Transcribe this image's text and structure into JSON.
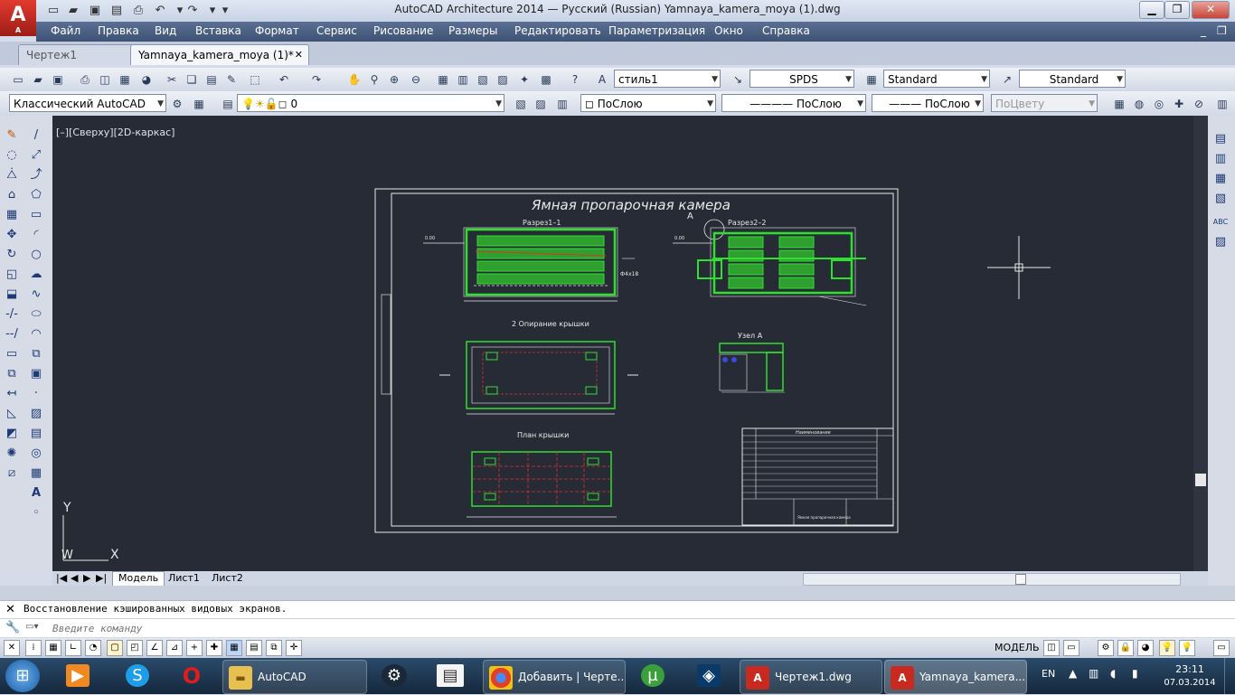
{
  "window": {
    "title": "AutoCAD Architecture 2014 — Русский (Russian)    Yamnaya_kamera_moya (1).dwg",
    "minimize": "▁",
    "maximize": "❐",
    "close": "✕"
  },
  "app_logo": {
    "letter": "A",
    "caption": "A"
  },
  "menu": [
    "Файл",
    "Правка",
    "Вид",
    "Вставка",
    "Формат",
    "Сервис",
    "Рисование",
    "Размеры",
    "Редактировать",
    "Параметризация",
    "Окно",
    "Справка"
  ],
  "doc_tabs": [
    {
      "label": "Чертеж1",
      "active": false
    },
    {
      "label": "Yamnaya_kamera_moya (1)*",
      "active": true
    }
  ],
  "toolbar1": {
    "text_style": "стиль1",
    "dim_style": "SPDS",
    "table_style": "Standard",
    "multileader_style": "Standard"
  },
  "toolbar2": {
    "workspace": "Классический AutoCAD",
    "layer": "0",
    "color": "ПоСлою",
    "linetype": "ПоСлою",
    "lineweight": "ПоСлою",
    "plotstyle": "ПоЦвету"
  },
  "viewport": {
    "label": "[–][Сверху][2D-каркас]"
  },
  "drawing": {
    "title": "Ямная пропарочная камера",
    "section1": "Разрез1–1",
    "section2": "Разрез2–2",
    "callout": "А",
    "support": "2 Опирание крышки",
    "node": "Узел А",
    "lid_plan": "План крышки",
    "level": "0.00",
    "size_note": "Ф4х18",
    "titleblock_header": "Наименование",
    "titleblock_caption": "Ямная пропарочная камера"
  },
  "ucs": {
    "y": "Y",
    "w": "W",
    "x": "X"
  },
  "layout_tabs": [
    "Модель",
    "Лист1",
    "Лист2"
  ],
  "command": {
    "history": "Восстановление кэшированных видовых экранов.",
    "placeholder": "Введите команду"
  },
  "status": {
    "model": "МОДЕЛЬ"
  },
  "taskbar": {
    "items": [
      {
        "label": "AutoCAD"
      },
      {
        "label": "Добавить | Черте..."
      },
      {
        "label": "Чертеж1.dwg"
      },
      {
        "label": "Yamnaya_kamera..."
      }
    ],
    "lang": "EN",
    "time": "23:11",
    "date": "07.03.2014"
  },
  "colors": {
    "canvas": "#262b36",
    "drawing_green": "#2fe02f",
    "drawing_red": "#e03030",
    "menu_bg": "#4b5f83"
  }
}
